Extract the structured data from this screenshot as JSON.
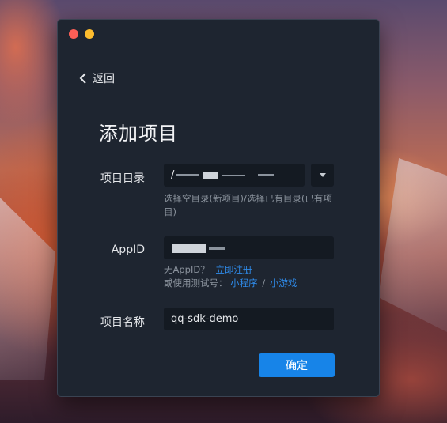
{
  "window": {
    "back_label": "返回",
    "title": "添加项目"
  },
  "form": {
    "project_dir": {
      "label": "项目目录",
      "value_prefix": "/",
      "hint": "选择空目录(新项目)/选择已有目录(已有项目)"
    },
    "appid": {
      "label": "AppID",
      "value_prefix": "",
      "hint_prefix": "无AppID？",
      "register_link": "立即注册",
      "test_prefix": "或使用测试号：",
      "mini_program_link": "小程序",
      "separator": "/",
      "mini_game_link": "小游戏"
    },
    "project_name": {
      "label": "项目名称",
      "value": "qq-sdk-demo"
    },
    "confirm_label": "确定"
  },
  "colors": {
    "window_bg": "#1e2530",
    "input_bg": "#141a22",
    "accent": "#1784e8",
    "link": "#2f8bea",
    "close": "#fc5f57",
    "minimize": "#fdbd2e"
  },
  "icons": {
    "back": "chevron-left-icon",
    "dropdown": "caret-down-icon"
  }
}
